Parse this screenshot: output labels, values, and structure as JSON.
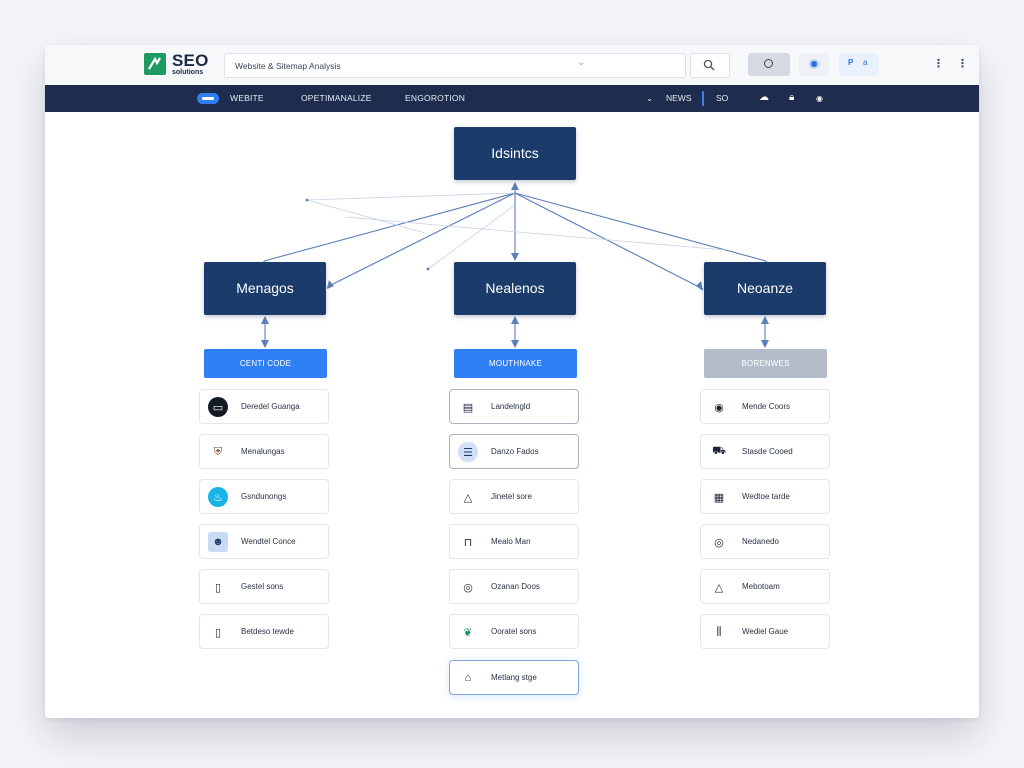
{
  "app": {
    "logo_title": "SEO",
    "logo_subtitle": "solutions"
  },
  "search": {
    "value": "Website & Sitemap Analysis",
    "placeholder": "Search"
  },
  "toolbar": {
    "btn3_a": "P",
    "btn3_b": "a",
    "kebab1": "⋮",
    "kebab2": "⋮"
  },
  "nav": {
    "items": [
      "WEBITE",
      "OPETIMANALIZE",
      "ENGOROTION"
    ],
    "right_chevron": "⌄",
    "right_label": "NEWS",
    "right_seo": "SO"
  },
  "diagram": {
    "root": "Idsintcs",
    "columns": [
      {
        "node": "Menagos",
        "category": "CENTI CODE",
        "category_style": "primary",
        "items": [
          {
            "icon": "code-icon",
            "glyph": "▭",
            "label": "Deredel Guanga",
            "icon_bg": "#121a26",
            "icon_color": "#ffffff"
          },
          {
            "icon": "badge-icon",
            "glyph": "⛨",
            "label": "Menalungas",
            "icon_bg": "#ffffff",
            "icon_color": "#7a3f1d"
          },
          {
            "icon": "bulb-icon",
            "glyph": "♨",
            "label": "Gsndunongs",
            "icon_bg": "#19b3e6",
            "icon_color": "#ffffff"
          },
          {
            "icon": "user-icon",
            "glyph": "☻",
            "label": "Wendtel Conce",
            "icon_bg": "#c9dbf3",
            "icon_color": "#1e3b6b"
          },
          {
            "icon": "phone-icon",
            "glyph": "▯",
            "label": "Gestel sons",
            "icon_bg": "#ffffff",
            "icon_color": "#1e2738"
          },
          {
            "icon": "device-icon",
            "glyph": "▯",
            "label": "Betdeso tewde",
            "icon_bg": "#ffffff",
            "icon_color": "#1e2738"
          }
        ]
      },
      {
        "node": "Nealenos",
        "category": "MOUTHNAKE",
        "category_style": "primary",
        "items": [
          {
            "icon": "document-icon",
            "glyph": "▤",
            "label": "Landelngld",
            "icon_bg": "#ffffff",
            "icon_color": "#1e2738"
          },
          {
            "icon": "list-icon",
            "glyph": "☰",
            "label": "Danzo Fados",
            "icon_bg": "#cfe0f7",
            "icon_color": "#1e3b6b"
          },
          {
            "icon": "bell-icon",
            "glyph": "△",
            "label": "Jinetel sore",
            "icon_bg": "#ffffff",
            "icon_color": "#1e2738"
          },
          {
            "icon": "lock-icon",
            "glyph": "⊓",
            "label": "Mealo Man",
            "icon_bg": "#ffffff",
            "icon_color": "#1e2738"
          },
          {
            "icon": "chat-icon",
            "glyph": "◎",
            "label": "Ozanan Doos",
            "icon_bg": "#ffffff",
            "icon_color": "#1e2738"
          },
          {
            "icon": "plant-icon",
            "glyph": "❦",
            "label": "Ooratel sons",
            "icon_bg": "#ffffff",
            "icon_color": "#1f8a7a"
          },
          {
            "icon": "building-icon",
            "glyph": "⌂",
            "label": "Metlang stge",
            "icon_bg": "#ffffff",
            "icon_color": "#1e2738"
          }
        ]
      },
      {
        "node": "Neoanze",
        "category": "BORENWES",
        "category_style": "muted",
        "items": [
          {
            "icon": "globe-icon",
            "glyph": "◉",
            "label": "Mende Coors",
            "icon_bg": "#ffffff",
            "icon_color": "#1e2738"
          },
          {
            "icon": "car-icon",
            "glyph": "⛟",
            "label": "Stasde Cooed",
            "icon_bg": "#ffffff",
            "icon_color": "#1e2738"
          },
          {
            "icon": "server-icon",
            "glyph": "▦",
            "label": "Wedtoe tarde",
            "icon_bg": "#ffffff",
            "icon_color": "#1e2738"
          },
          {
            "icon": "egg-icon",
            "glyph": "◎",
            "label": "Nedanedo",
            "icon_bg": "#ffffff",
            "icon_color": "#1e2738"
          },
          {
            "icon": "bell-icon",
            "glyph": "△",
            "label": "Mebotoam",
            "icon_bg": "#ffffff",
            "icon_color": "#1e2738"
          },
          {
            "icon": "columns-icon",
            "glyph": "⫼",
            "label": "Wediel Gaue",
            "icon_bg": "#ffffff",
            "icon_color": "#1e2738"
          }
        ]
      }
    ]
  },
  "colors": {
    "nav_bg": "#1e2d4d",
    "node_bg": "#1b3b6b",
    "accent": "#2f80f5",
    "muted_category": "#b4bcc9",
    "link": "#5b7fb8",
    "brand": "#1f9a62"
  }
}
